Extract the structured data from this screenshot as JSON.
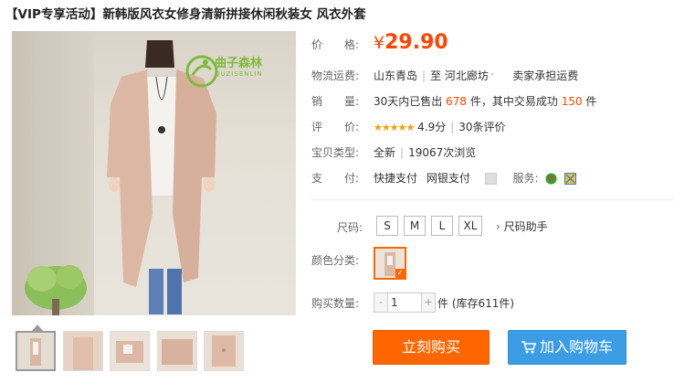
{
  "product": {
    "title": "【VIP专享活动】新韩版风衣女修身清新拼接休闲秋装女 风衣外套",
    "logo_name": "曲子森林",
    "logo_sub": "QUZISENLIN"
  },
  "price": {
    "label": "价　　格:",
    "symbol": "¥",
    "value": "29.90"
  },
  "shipping": {
    "label": "物流运费:",
    "from": "山东青岛",
    "to_prefix": "至",
    "to": "河北廊坊",
    "fee": "卖家承担运费"
  },
  "sales": {
    "label": "销　　量:",
    "prefix": "30天内已售出",
    "sold": "678",
    "mid": "件，其中交易成功",
    "success": "150",
    "suffix": "件"
  },
  "rating": {
    "label": "评　　价:",
    "stars": "★★★★★",
    "score": "4.9分",
    "reviews": "30条评价"
  },
  "item_type": {
    "label": "宝贝类型:",
    "condition": "全新",
    "views": "19067次浏览"
  },
  "payment": {
    "label": "支　　付:",
    "methods": [
      "快捷支付",
      "网银支付"
    ],
    "service_label": "服务:"
  },
  "size": {
    "label": "尺码:",
    "options": [
      "S",
      "M",
      "L",
      "XL"
    ],
    "helper": "尺码助手"
  },
  "color": {
    "label": "颜色分类:"
  },
  "quantity": {
    "label": "购买数量:",
    "value": "1",
    "minus": "-",
    "plus": "+",
    "note": "件 (库存611件)"
  },
  "actions": {
    "buy": "立刻购买",
    "cart": "加入购物车"
  },
  "colors": {
    "accent": "#ff4400",
    "buy_button": "#ff6600",
    "cart_button": "#3d9de4"
  }
}
